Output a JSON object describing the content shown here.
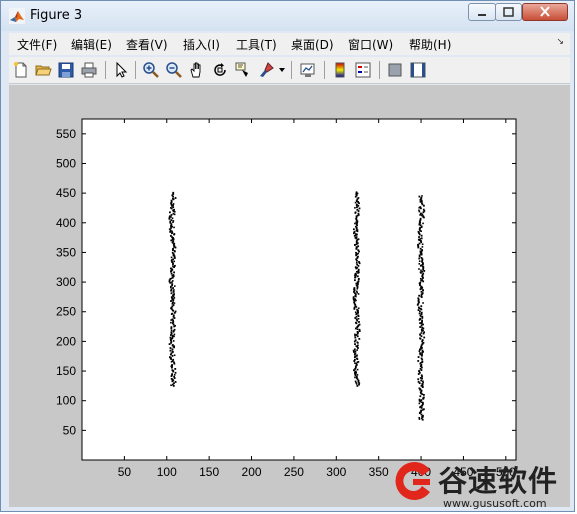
{
  "window": {
    "title": "Figure 3"
  },
  "menu": [
    "文件(F)",
    "编辑(E)",
    "查看(V)",
    "插入(I)",
    "工具(T)",
    "桌面(D)",
    "窗口(W)",
    "帮助(H)"
  ],
  "toolbar_icons": [
    "new-figure-icon",
    "open-file-icon",
    "save-figure-icon",
    "print-figure-icon",
    "edit-plot-icon",
    "zoom-in-icon",
    "zoom-out-icon",
    "pan-icon",
    "rotate-3d-icon",
    "data-cursor-icon",
    "brush-icon",
    "link-plot-icon",
    "insert-colorbar-icon",
    "insert-legend-icon",
    "hide-plot-tools-icon",
    "show-plot-tools-icon"
  ],
  "chart_data": {
    "type": "scatter",
    "xlim": [
      0,
      512
    ],
    "ylim": [
      0,
      575
    ],
    "xticks": [
      50,
      100,
      150,
      200,
      250,
      300,
      350,
      400,
      450,
      500
    ],
    "yticks": [
      50,
      100,
      150,
      200,
      250,
      300,
      350,
      400,
      450,
      500,
      550
    ],
    "grid": false,
    "stripes": [
      {
        "x_center": 107,
        "y_min": 125,
        "y_max": 452
      },
      {
        "x_center": 324,
        "y_min": 125,
        "y_max": 452
      },
      {
        "x_center": 400,
        "y_min": 68,
        "y_max": 446
      }
    ]
  },
  "watermark": {
    "text": "谷速软件",
    "url": "www.gususoft.com"
  }
}
